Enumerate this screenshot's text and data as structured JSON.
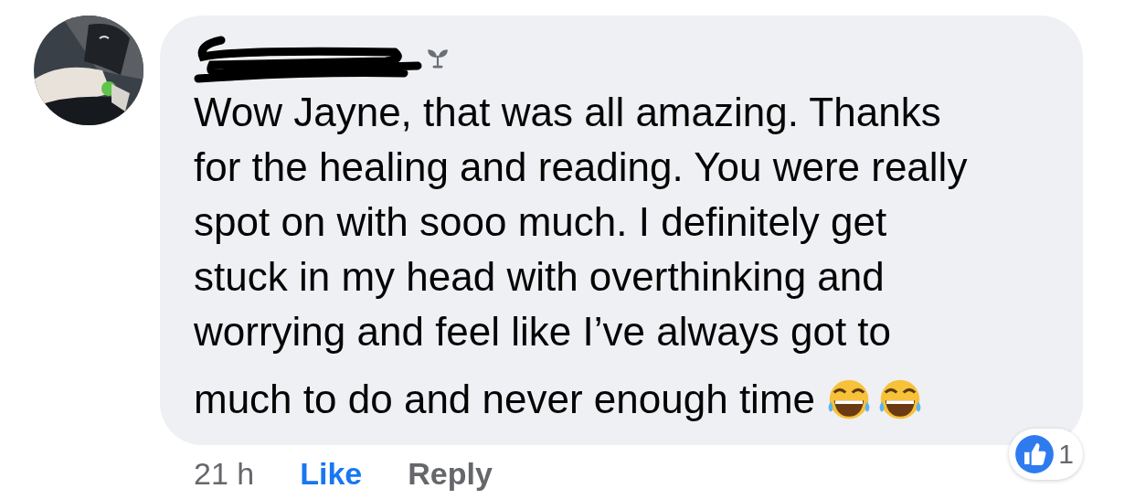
{
  "comment": {
    "text_lines": [
      "Wow Jayne, that was all amazing. Thanks",
      "for the healing and reading. You were really",
      "spot on with sooo much. I definitely get",
      "stuck in my head with overthinking and",
      "worrying and feel like I’ve always got to",
      "much to do and never enough time"
    ],
    "reactions": {
      "count": "1"
    },
    "time": "21 h",
    "like": {
      "label": "Like",
      "liked": true
    },
    "reply": "Reply"
  }
}
